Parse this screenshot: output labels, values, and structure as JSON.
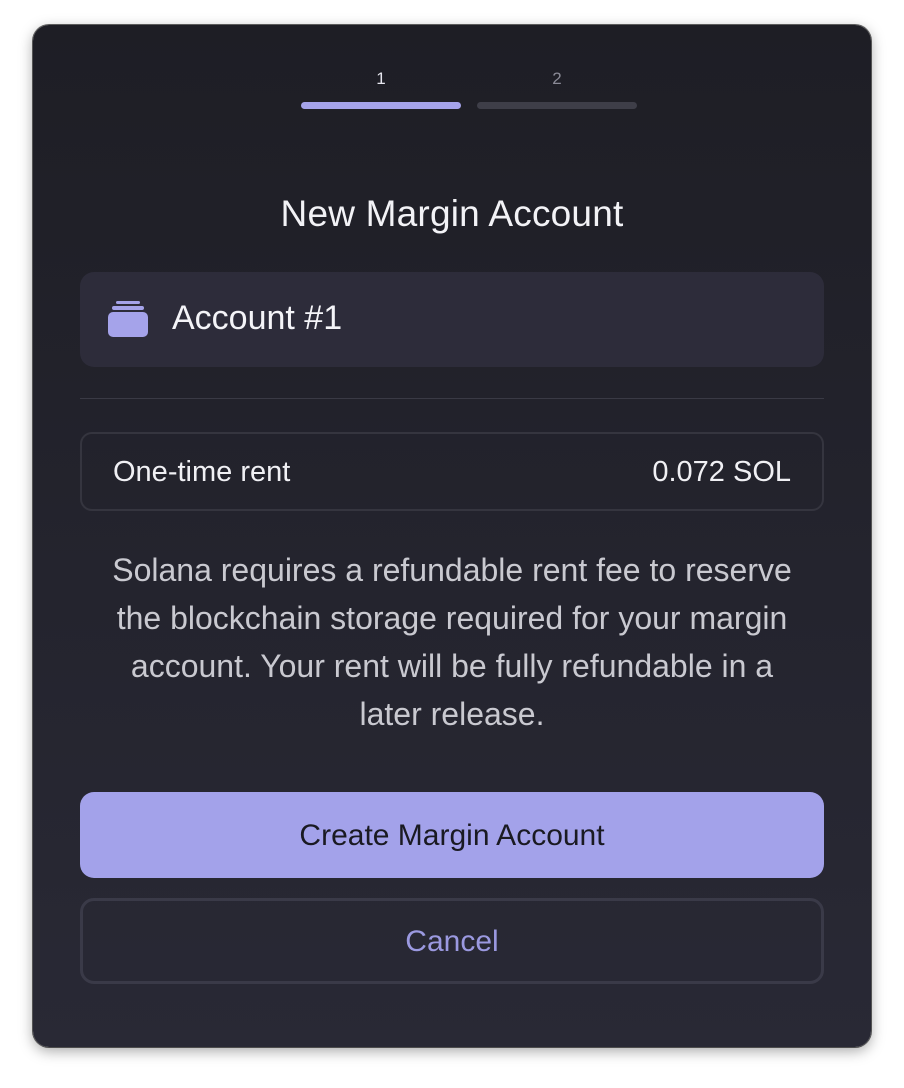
{
  "stepper": {
    "steps": [
      {
        "number": "1",
        "active": true
      },
      {
        "number": "2",
        "active": false
      }
    ],
    "active_color": "#a5a3ea",
    "inactive_color": "#3e3e48"
  },
  "modal": {
    "title": "New Margin Account"
  },
  "account": {
    "icon": "stacked-accounts-icon",
    "name": "Account #1"
  },
  "rent": {
    "label": "One-time rent",
    "value": "0.072 SOL"
  },
  "description": "Solana requires a refundable rent fee to reserve the blockchain storage required for your margin account. Your rent will be fully refundable in a later release.",
  "actions": {
    "create_label": "Create Margin Account",
    "cancel_label": "Cancel"
  },
  "colors": {
    "accent": "#a3a2ea",
    "background": "#24242e"
  }
}
